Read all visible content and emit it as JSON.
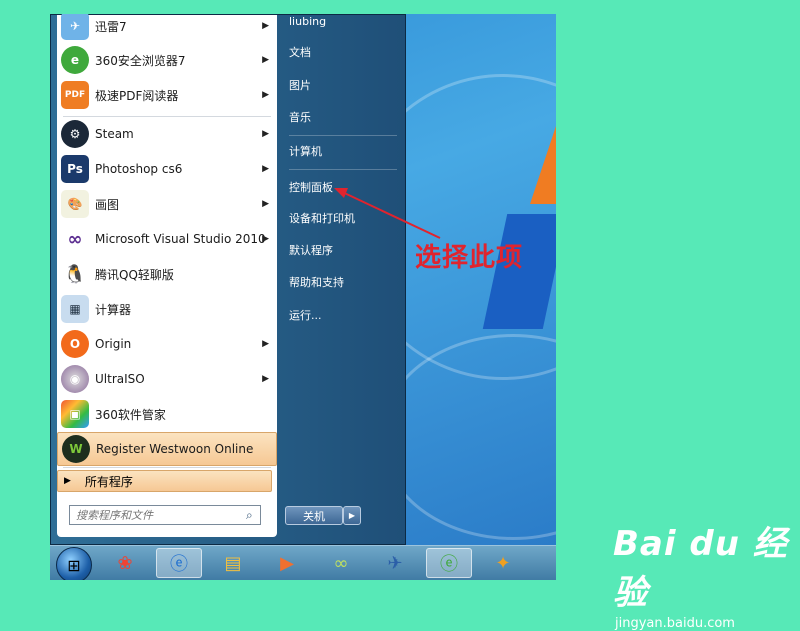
{
  "left_menu": {
    "items": [
      {
        "label": "迅雷7",
        "icon": "xunlei-icon",
        "has_arrow": true
      },
      {
        "label": "360安全浏览器7",
        "icon": "360-browser-icon",
        "has_arrow": true
      },
      {
        "label": "极速PDF阅读器",
        "icon": "pdf-reader-icon",
        "has_arrow": true
      },
      {
        "label": "Steam",
        "icon": "steam-icon",
        "has_arrow": true
      },
      {
        "label": "Photoshop cs6",
        "icon": "photoshop-icon",
        "has_arrow": true
      },
      {
        "label": "画图",
        "icon": "paint-icon",
        "has_arrow": true
      },
      {
        "label": "Microsoft Visual Studio 2010",
        "icon": "visual-studio-icon",
        "has_arrow": true
      },
      {
        "label": "腾讯QQ轻聊版",
        "icon": "qq-icon",
        "has_arrow": false
      },
      {
        "label": "计算器",
        "icon": "calculator-icon",
        "has_arrow": false
      },
      {
        "label": "Origin",
        "icon": "origin-icon",
        "has_arrow": true
      },
      {
        "label": "UltraISO",
        "icon": "ultraiso-icon",
        "has_arrow": true
      },
      {
        "label": "360软件管家",
        "icon": "360-software-icon",
        "has_arrow": false
      },
      {
        "label": "Register Westwoon Online",
        "icon": "westwood-icon",
        "has_arrow": false
      }
    ],
    "all_programs": "所有程序",
    "search_placeholder": "搜索程序和文件"
  },
  "right_menu": {
    "items": [
      "liubing",
      "文档",
      "图片",
      "音乐",
      "计算机",
      "控制面板",
      "设备和打印机",
      "默认程序",
      "帮助和支持",
      "运行..."
    ],
    "shutdown_label": "关机"
  },
  "annotation": {
    "text": "选择此项",
    "color": "#e0242e"
  },
  "watermark": {
    "brand": "Bai du 经验",
    "url": "jingyan.baidu.com"
  },
  "taskbar": {
    "icons": [
      "windows-start-icon",
      "360-icon",
      "ie-icon",
      "explorer-icon",
      "media-player-icon",
      "network-icon",
      "xunlei-icon",
      "360-browser-icon",
      "game-icon"
    ]
  }
}
